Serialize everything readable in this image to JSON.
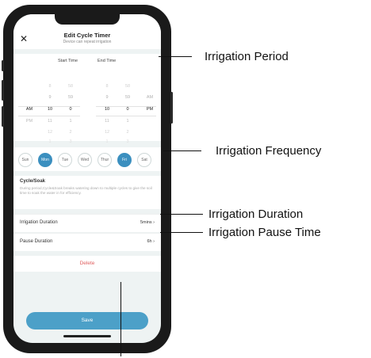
{
  "app": {
    "title": "Edit Cycle Timer",
    "subtitle": "Device can repeat irrigation"
  },
  "picker": {
    "start_label": "Start Time",
    "end_label": "End Time",
    "start": {
      "ampm": [
        "",
        "",
        "AM",
        "PM",
        "",
        ""
      ],
      "hours": [
        "8",
        "9",
        "10",
        "11",
        "12",
        "1"
      ],
      "minutes": [
        "58",
        "59",
        "0",
        "1",
        "2",
        "3"
      ]
    },
    "end": {
      "hours": [
        "8",
        "9",
        "10",
        "11",
        "12",
        "1"
      ],
      "minutes": [
        "58",
        "59",
        "0",
        "1",
        "2",
        "3"
      ],
      "ampm": [
        "",
        "AM",
        "PM",
        "",
        "",
        ""
      ]
    }
  },
  "days": [
    {
      "label": "Sun",
      "active": false
    },
    {
      "label": "Mon",
      "active": true
    },
    {
      "label": "Tue",
      "active": false
    },
    {
      "label": "Wed",
      "active": false
    },
    {
      "label": "Thur",
      "active": false
    },
    {
      "label": "Fri",
      "active": true
    },
    {
      "label": "Sat",
      "active": false
    }
  ],
  "cycle": {
    "title": "Cycle/Soak",
    "description": "During period,Cycle&Soak breaks watering down to multiple cycles to give the soil time to soak the water in for efficiency."
  },
  "rows": {
    "duration_label": "Irrigation Duration",
    "duration_value": "5mins",
    "pause_label": "Pause  Duration",
    "pause_value": "6h"
  },
  "delete_label": "Delete",
  "save_label": "Save",
  "callouts": {
    "period": "Irrigation Period",
    "frequency": "Irrigation Frequency",
    "duration": "Irrigation Duration",
    "pause": "Irrigation Pause Time"
  },
  "colors": {
    "accent": "#3b8fbf",
    "save": "#4ca0c8",
    "delete": "#e06060"
  }
}
